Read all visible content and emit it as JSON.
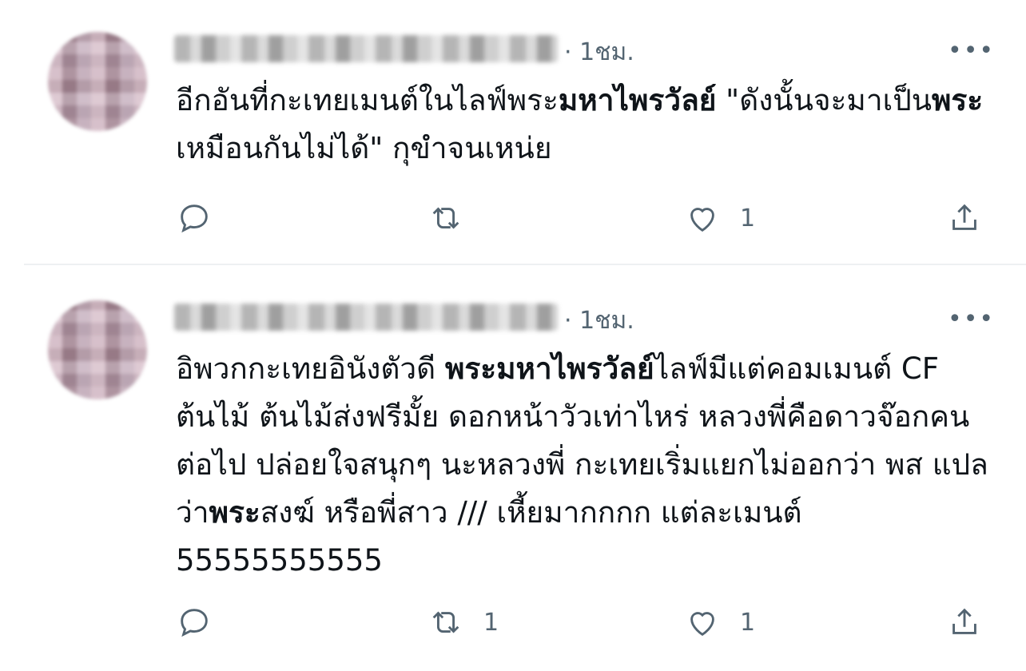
{
  "tweets": [
    {
      "time": "· 1ชม.",
      "more": "•••",
      "text": {
        "p1": "อีกอันที่กะเทยเมนต์ในไลฟ์พระ",
        "b1": "มหาไพรวัลย์",
        "p2": " \"ดังนั้นจะมาเป็น",
        "b2": "พระ",
        "p3": "เหมือนกันไม่ได้\" กุขำจนเหน่ย"
      },
      "replies": "",
      "retweets": "",
      "likes": "1"
    },
    {
      "time": "· 1ชม.",
      "more": "•••",
      "text": {
        "p1": "อิพวกกะเทยอินังตัวดี ",
        "b1": "พระมหาไพรวัลย์",
        "p2": "ไลฟ์มีแต่คอมเมนต์ CF ต้นไม้ ต้นไม้ส่งฟรีมั้ย ดอกหน้าวัวเท่าไหร่ หลวงพี่คือดาวจ๊อกคนต่อไป ปล่อยใจสนุกๆ นะหลวงพี่ กะเทยเริ่มแยกไม่ออกว่า พส แปลว่า",
        "b2": "พระ",
        "p3": "สงฆ์ หรือพี่สาว /// เหี้ยมากกกก แต่ละเมนต์ 55555555555"
      },
      "replies": "",
      "retweets": "1",
      "likes": "1"
    }
  ],
  "icons": {
    "reply": "reply-icon",
    "retweet": "retweet-icon",
    "like": "heart-icon",
    "share": "share-icon"
  },
  "colors": {
    "text": "#0f1419",
    "secondary": "#536471",
    "divider": "#eef0f2"
  }
}
